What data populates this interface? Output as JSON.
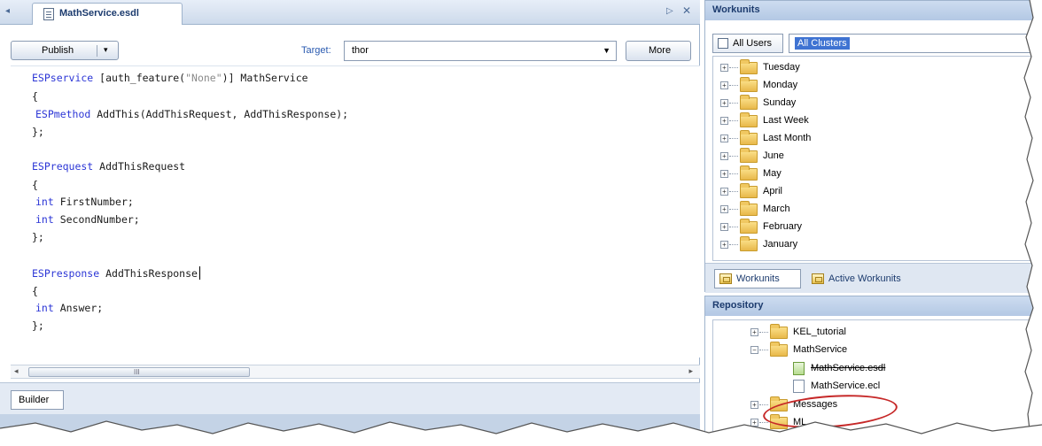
{
  "editor": {
    "tab_title": "MathService.esdl",
    "tab_nav_left": "◂",
    "tab_nav_right": "▷",
    "tab_close": "✕",
    "toolbar": {
      "publish_label": "Publish",
      "publish_arrow": "▾",
      "target_label": "Target:",
      "target_value": "thor",
      "target_arrow": "▼",
      "more_label": "More"
    },
    "code": {
      "l1_kw": "ESPservice",
      "l1_a": " [auth_feature(",
      "l1_str": "\"None\"",
      "l1_b": ")] MathService",
      "l2": "{",
      "l3_kw": "ESPmethod",
      "l3_rest": " AddThis(AddThisRequest, AddThisResponse);",
      "l4": "};",
      "l6_kw": "ESPrequest",
      "l6_rest": " AddThisRequest",
      "l7": "{",
      "l8_type": "int",
      "l8_rest": " FirstNumber;",
      "l9_type": "int",
      "l9_rest": " SecondNumber;",
      "l10": "};",
      "l12_kw": "ESPresponse",
      "l12_rest": " AddThisResponse",
      "l13": "{",
      "l14_type": "int",
      "l14_rest": " Answer;",
      "l15": "};"
    },
    "scroll_left": "◂",
    "scroll_right": "▸",
    "scroll_grip": "III",
    "bottom_tab_label": "Builder"
  },
  "workunits": {
    "title": "Workunits",
    "all_users_label": "All Users",
    "cluster_value": "All Clusters",
    "tree_items": [
      "Tuesday",
      "Monday",
      "Sunday",
      "Last Week",
      "Last Month",
      "June",
      "May",
      "April",
      "March",
      "February",
      "January"
    ],
    "expander_symbol": "+",
    "tabs": [
      {
        "label": "Workunits"
      },
      {
        "label": "Active Workunits"
      }
    ]
  },
  "repository": {
    "title": "Repository",
    "items": [
      {
        "label": "KEL_tutorial",
        "expander": "+"
      },
      {
        "label": "MathService",
        "expander": "−"
      },
      {
        "label": "MathService.esdl"
      },
      {
        "label": "MathService.ecl"
      },
      {
        "label": "Messages",
        "expander": "+"
      },
      {
        "label": "ML",
        "expander": "+"
      }
    ]
  },
  "colors": {
    "keyword": "#2c36d6",
    "string": "#8a8a8a",
    "selection": "#3f73d2",
    "annotation_ellipse": "#c62828",
    "panel_header": "#b3c8e4"
  }
}
